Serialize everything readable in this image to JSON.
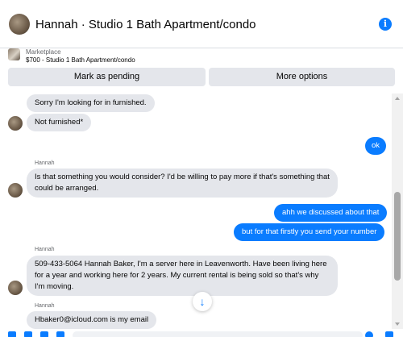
{
  "header": {
    "title": "Hannah · Studio 1 Bath Apartment/condo",
    "info_icon": "info-icon",
    "info_glyph": "i"
  },
  "listing": {
    "source": "Marketplace",
    "price_title": "$700 - Studio 1 Bath Apartment/condo",
    "mark_pending_label": "Mark as pending",
    "more_options_label": "More options"
  },
  "messages": [
    {
      "from": "Hannah",
      "text": "Sorry I'm looking for in furnished."
    },
    {
      "from": "Hannah",
      "text": "Not furnished*"
    },
    {
      "from": "me",
      "text": "ok"
    },
    {
      "sender_label": "Hannah"
    },
    {
      "from": "Hannah",
      "text": "Is that something you would consider? I'd be willing to pay more if that's something that could be arranged."
    },
    {
      "from": "me",
      "text": "ahh we discussed about that"
    },
    {
      "from": "me",
      "text": "but for that firstly you send your number"
    },
    {
      "sender_label": "Hannah"
    },
    {
      "from": "Hannah",
      "text": "509-433-5064 Hannah Baker, I'm a server here in Leavenworth. Have been living here for a year and working here for 2 years. My current rental is being sold so that's why I'm moving."
    },
    {
      "sender_label": "Hannah"
    },
    {
      "from": "Hannah",
      "text": "Hbaker0@icloud.com is my email"
    }
  ],
  "scroll_down_glyph": "↓",
  "colors": {
    "accent": "#0a7cff",
    "incoming_bubble": "#e4e6eb",
    "button_bg": "#e4e6eb",
    "muted_text": "#65676b"
  }
}
